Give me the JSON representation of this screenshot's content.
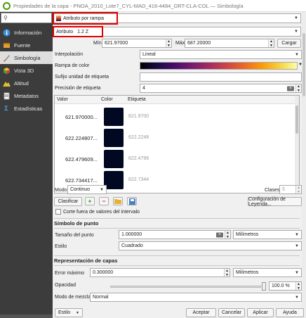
{
  "window": {
    "title": "Propiedades de la capa - PNOA_2010_Lote7_CYL-MAD_416-4484_ORT-CLA-COL — Simbología"
  },
  "sidebar": {
    "search_placeholder": "",
    "items": [
      {
        "label": "Información",
        "icon": "info-icon"
      },
      {
        "label": "Fuente",
        "icon": "source-icon"
      },
      {
        "label": "Simbología",
        "icon": "paintbrush-icon"
      },
      {
        "label": "Vista 3D",
        "icon": "cube-icon"
      },
      {
        "label": "Altitud",
        "icon": "elevation-icon"
      },
      {
        "label": "Metadatos",
        "icon": "metadata-icon"
      },
      {
        "label": "Estadísticas",
        "icon": "sigma-icon"
      }
    ],
    "active_index": 2
  },
  "renderer": {
    "value": "Atributo por rampa"
  },
  "attribute": {
    "label": "Atributo",
    "value": "1.2 Z"
  },
  "minmax": {
    "min_label": "Mín",
    "min_value": "621.97000",
    "max_label": "Máx",
    "max_value": "687.20000",
    "load_button": "Cargar"
  },
  "interpolation": {
    "label": "Interpolación",
    "value": "Lineal"
  },
  "color_ramp": {
    "label": "Rampa de color"
  },
  "suffix": {
    "label": "Sufijo unidad de etiqueta",
    "value": ""
  },
  "precision": {
    "label": "Precisión de etiqueta",
    "value": "4"
  },
  "table": {
    "columns": [
      "Valor",
      "Color",
      "Etiqueta"
    ],
    "rows": [
      {
        "value": "621.970000...",
        "color": "#000822",
        "label": "621.9700"
      },
      {
        "value": "622.224807...",
        "color": "#000822",
        "label": "622.2248"
      },
      {
        "value": "622.479609...",
        "color": "#000822",
        "label": "622.4796"
      },
      {
        "value": "622.734417...",
        "color": "#000822",
        "label": "622.7344"
      }
    ]
  },
  "mode": {
    "label": "Modo",
    "value": "Continuo",
    "classes_label": "Clases",
    "classes_value": "5"
  },
  "actions": {
    "classify": "Clasificar",
    "legend_config": "Configuración de Leyenda..."
  },
  "clip": {
    "label": "Corte fuera de valores del intervalo"
  },
  "point_symbol": {
    "section": "Símbolo de punto",
    "size_label": "Tamaño del punto",
    "size_value": "1.000000",
    "size_unit": "Milímetros",
    "style_label": "Estilo",
    "style_value": "Cuadrado"
  },
  "layer_render": {
    "section": "Representación de capas",
    "max_error_label": "Error máximo",
    "max_error_value": "0.300000",
    "max_error_unit": "Milímetros",
    "opacity_label": "Opacidad",
    "opacity_value": "100.0 %",
    "blend_label": "Modo de mezcla",
    "blend_value": "Normal"
  },
  "footer": {
    "style": "Estilo",
    "accept": "Aceptar",
    "cancel": "Cancelar",
    "apply": "Aplicar",
    "help": "Ayuda"
  }
}
